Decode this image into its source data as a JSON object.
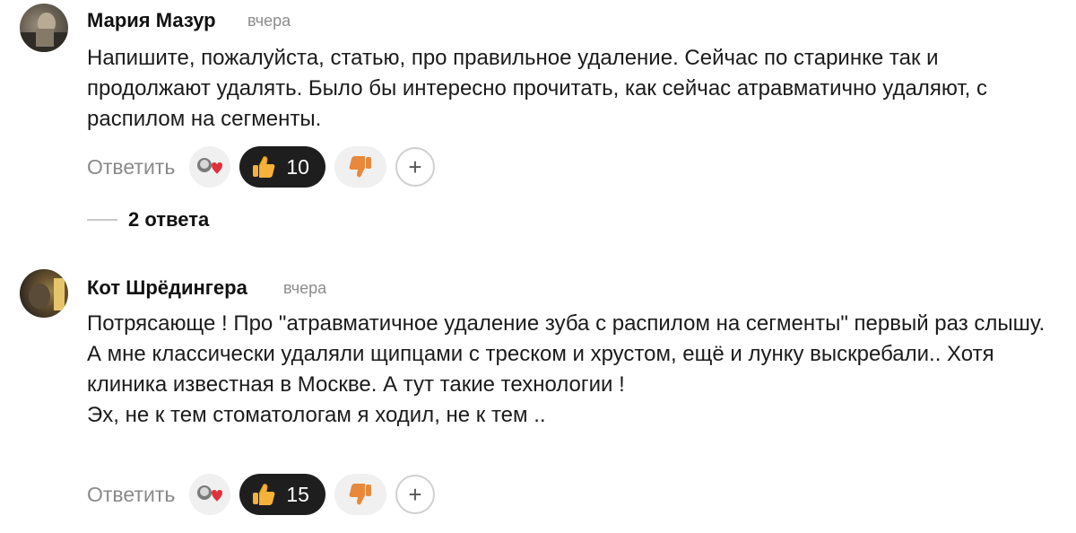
{
  "comments": [
    {
      "author": "Мария Мазур",
      "time": "вчера",
      "text": "Напишите, пожалуйста, статью, про правильное удаление. Сейчас по старинке так и продолжают удалять. Было бы интересно прочитать, как сейчас атравматично удаляют, с распилом на сегменты.",
      "reply_label": "Ответить",
      "like_count": "10",
      "add_reaction": "+",
      "replies_label": "2 ответа"
    },
    {
      "author": "Кот Шрёдингера",
      "time": "вчера",
      "text": "Потрясающе ! Про \"атравматичное удаление зуба с распилом на сегменты\" первый раз слышу. А мне классически удаляли щипцами с треском и хрустом, ещё и лунку выскребали.. Хотя клиника известная в Москве. А тут такие технологии !\nЭх, не к тем стоматологам я ходил, не к тем ..",
      "reply_label": "Ответить",
      "like_count": "15",
      "add_reaction": "+"
    }
  ],
  "icons": {
    "reactions_preview": "reactions-preview-icon",
    "like": "thumbs-up-icon",
    "dislike": "thumbs-down-icon",
    "add": "plus-icon"
  },
  "colors": {
    "like_pill": "#1e1e1e",
    "secondary_text": "#8a8a8a",
    "thumb": "#f4b23a",
    "dislike_thumb": "#e8883a",
    "heart": "#e0313f"
  }
}
